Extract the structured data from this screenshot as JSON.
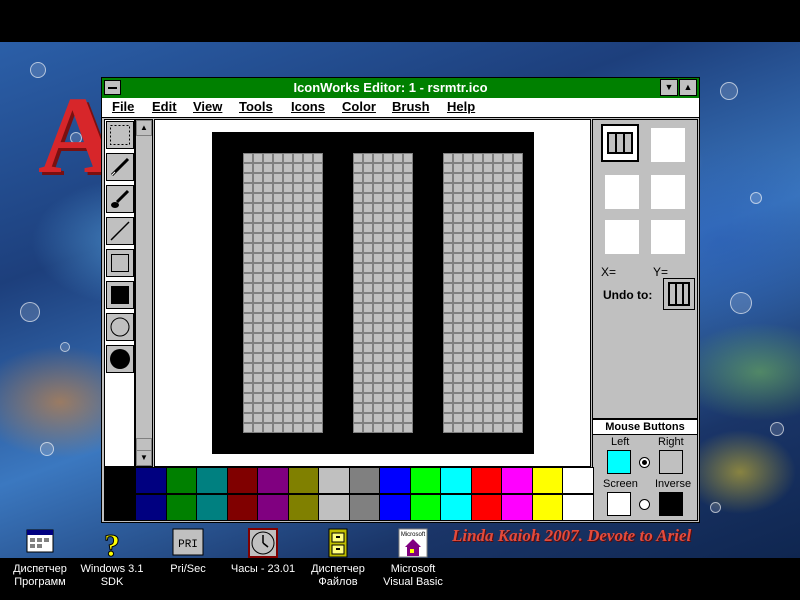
{
  "window": {
    "title": "IconWorks Editor: 1 - rsrmtr.ico",
    "titlebar_color": "#008000",
    "menus": [
      "File",
      "Edit",
      "View",
      "Tools",
      "Icons",
      "Color",
      "Brush",
      "Help"
    ]
  },
  "tools": [
    {
      "name": "select-tool",
      "icon": "dotted-select-icon",
      "active": true
    },
    {
      "name": "pencil-tool",
      "icon": "pencil-icon"
    },
    {
      "name": "brush-tool",
      "icon": "brush-icon"
    },
    {
      "name": "line-tool",
      "icon": "line-icon"
    },
    {
      "name": "rectangle-tool",
      "icon": "hollow-rectangle-icon"
    },
    {
      "name": "filled-rectangle-tool",
      "icon": "filled-rectangle-icon"
    },
    {
      "name": "ellipse-tool",
      "icon": "hollow-ellipse-icon"
    },
    {
      "name": "filled-ellipse-tool",
      "icon": "filled-ellipse-icon"
    }
  ],
  "icon_grid": {
    "size": 32,
    "description_colors": {
      "border": "#000000",
      "fill": "#c0c0c0",
      "gridline": "#808080"
    },
    "black_columns": [
      0,
      1,
      2,
      11,
      12,
      13,
      20,
      21,
      22,
      31
    ],
    "black_rows": [
      0,
      1,
      30,
      31
    ]
  },
  "panel": {
    "x_label": "X=",
    "y_label": "Y=",
    "undo_label": "Undo to:",
    "mouse_title": "Mouse Buttons",
    "left_label": "Left",
    "right_label": "Right",
    "screen_label": "Screen",
    "inverse_label": "Inverse",
    "left_color": "#00ffff",
    "right_color": "#c0c0c0",
    "screen_color": "#ffffff",
    "inverse_color": "#000000",
    "selected_button": "left"
  },
  "palette": {
    "top": [
      "#000080",
      "#008000",
      "#008080",
      "#800000",
      "#800080",
      "#808000",
      "#c0c0c0",
      "#808080",
      "#0000ff",
      "#00ff00",
      "#00ffff",
      "#ff0000",
      "#ff00ff",
      "#ffff00",
      "#ffffff"
    ],
    "bottom": [
      "#000080",
      "#008000",
      "#008080",
      "#800000",
      "#800080",
      "#808000",
      "#c0c0c0",
      "#808080",
      "#0000ff",
      "#00ff00",
      "#00ffff",
      "#ff0000",
      "#ff00ff",
      "#ffff00",
      "#ffffff"
    ],
    "first_cell": "#000000"
  },
  "desktop": {
    "background_letter": "A",
    "credit": "Linda Kaioh 2007. Devote to Ariel",
    "icons": [
      {
        "label1": "Диспетчер",
        "label2": "Программ",
        "icon": "program-manager-icon"
      },
      {
        "label1": "Windows 3.1",
        "label2": "SDK",
        "icon": "help-question-icon"
      },
      {
        "label1": "Pri/Sec",
        "label2": "",
        "icon": "pri-sec-icon"
      },
      {
        "label1": "Часы - 23.01",
        "label2": "",
        "icon": "clock-icon"
      },
      {
        "label1": "Диспетчер",
        "label2": "Файлов",
        "icon": "file-cabinet-icon"
      },
      {
        "label1": "Microsoft",
        "label2": "Visual Basic",
        "icon": "visual-basic-icon"
      }
    ],
    "pri_text": "PRI",
    "vb_text": "Microsoft"
  }
}
